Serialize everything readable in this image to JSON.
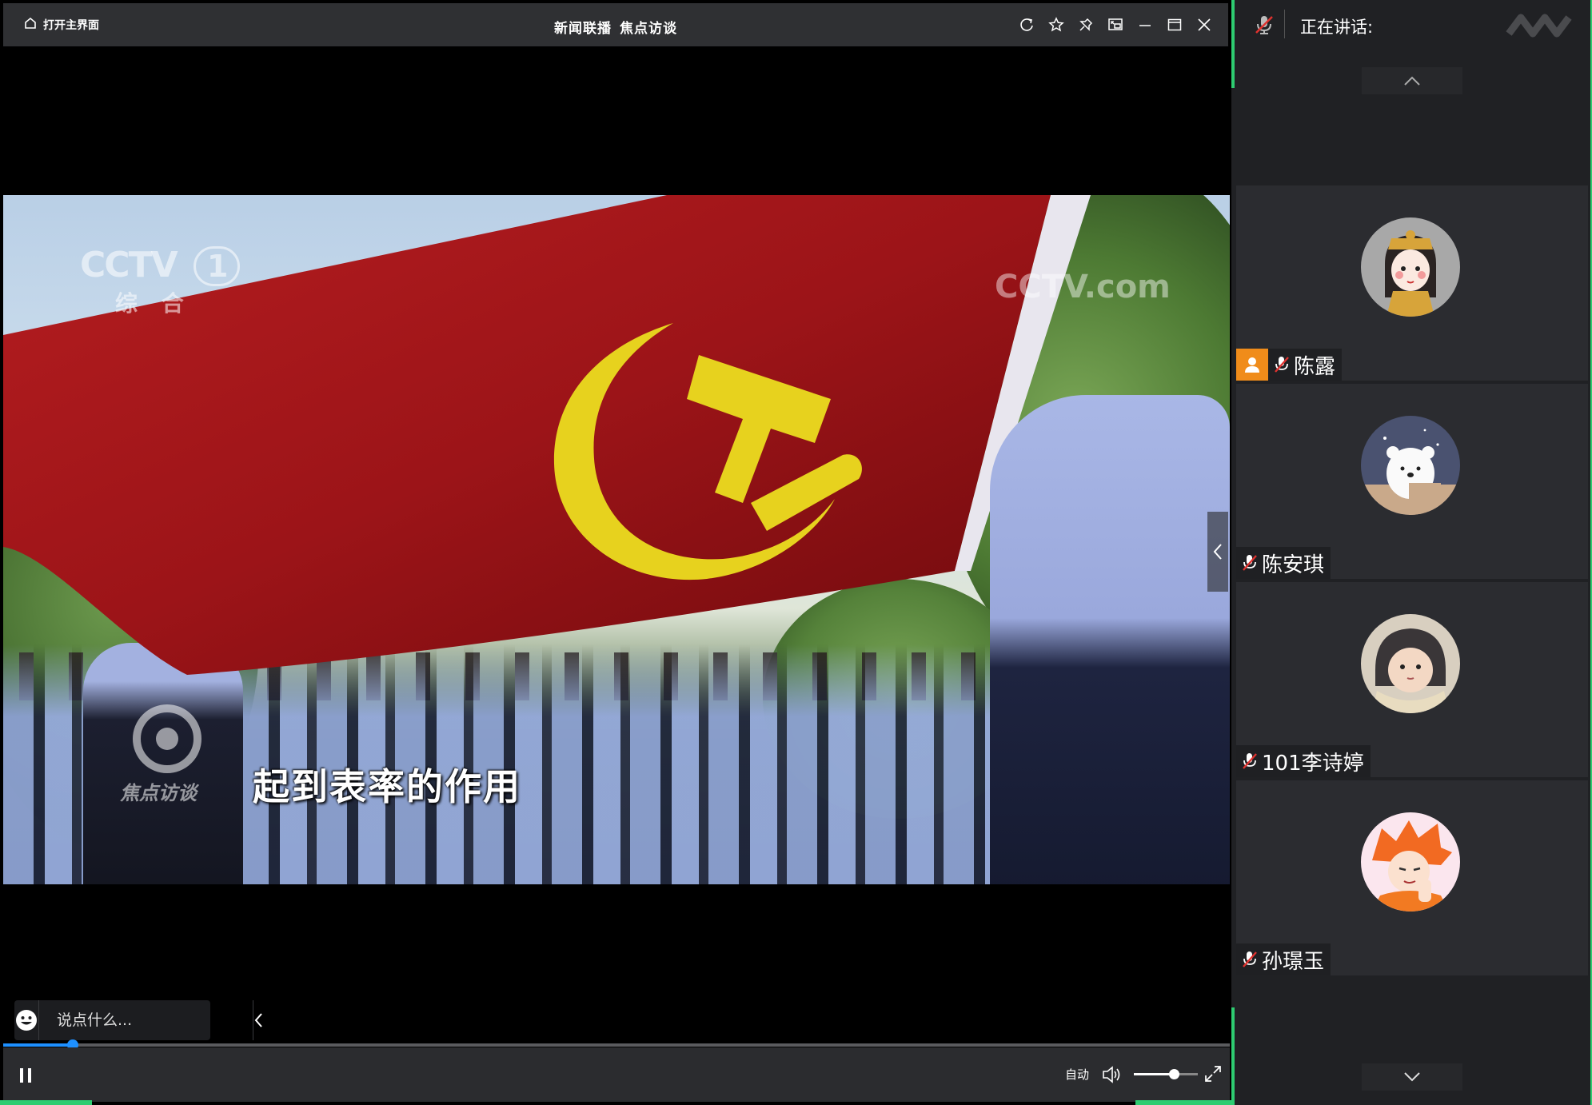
{
  "window": {
    "home_label": "打开主界面",
    "title_part1": "新闻联播",
    "title_part2": "焦点访谈",
    "controls": [
      "refresh-icon",
      "star-icon",
      "pin-icon",
      "picture-in-picture-icon",
      "minimize-icon",
      "maximize-icon",
      "close-icon"
    ]
  },
  "video": {
    "channel_logo_top": "CCTV",
    "channel_logo_number": "1",
    "channel_logo_sub": "综 合",
    "watermark": "CCTV.com",
    "program_logo": "焦点访谈",
    "subtitle": "起到表率的作用"
  },
  "comment": {
    "placeholder": "说点什么..."
  },
  "player": {
    "progress_fraction": 0.057,
    "quality_label": "自动",
    "volume_fraction": 0.62,
    "accent_color": "#1e90ff"
  },
  "panel": {
    "speaking_label": "正在讲话:",
    "participants": [
      {
        "name": "陈露",
        "host": true,
        "muted": true,
        "avatar": "cartoon-empress-avatar"
      },
      {
        "name": "陈安琪",
        "host": false,
        "muted": true,
        "avatar": "polar-bear-avatar"
      },
      {
        "name": "101李诗婷",
        "host": false,
        "muted": true,
        "avatar": "child-photo-avatar"
      },
      {
        "name": "孙璟玉",
        "host": false,
        "muted": true,
        "avatar": "anime-boy-avatar"
      }
    ],
    "accent_color": "#2ecc71"
  }
}
